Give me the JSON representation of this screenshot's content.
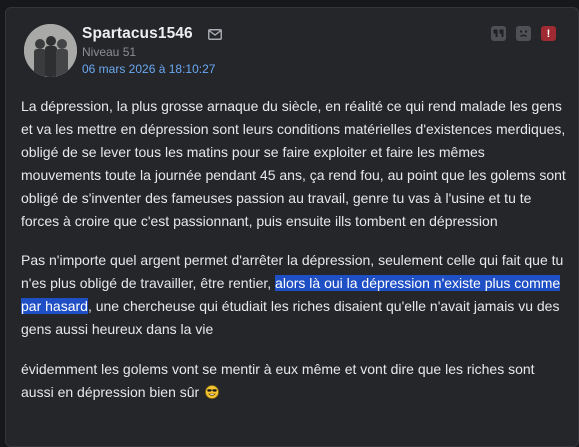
{
  "post": {
    "author": "Spartacus1546",
    "level": "Niveau 51",
    "date": "06 mars 2026 à 18:10:27",
    "icons": {
      "mail": "envelope-icon",
      "quote": "quote-icon",
      "ignore": "ignore-user-icon",
      "report": "report-icon"
    },
    "report_glyph": "!",
    "paragraphs": {
      "p1": "La dépression, la plus grosse arnaque du siècle, en réalité ce qui rend malade les gens et va les mettre en dépression sont leurs conditions matérielles d'existences merdiques, obligé de se lever tous les matins pour se faire exploiter et faire les mêmes mouvements toute la journée pendant 45 ans, ça rend fou, au point que les golems sont obligé de s'inventer des fameuses passion au travail, genre tu vas à l'usine et tu te forces à croire que c'est passionnant, puis ensuite ills tombent en dépression",
      "p2_before": "Pas n'importe quel argent permet d'arrêter la dépression, seulement celle qui fait que tu n'es plus obligé de travailler, être rentier, ",
      "p2_highlight": "alors là oui la dépression n'existe plus comme par hasard",
      "p2_after": ", une chercheuse qui étudiait les riches disaient qu'elle n'avait jamais vu des gens aussi heureux dans la vie",
      "p3": "évidemment les golems vont se mentir à eux même et vont dire que les riches sont aussi en dépression bien sûr "
    },
    "colors": {
      "background": "#25262a",
      "link": "#6aa9f2",
      "highlight": "#1f4fc4",
      "report": "#a02a32"
    }
  }
}
